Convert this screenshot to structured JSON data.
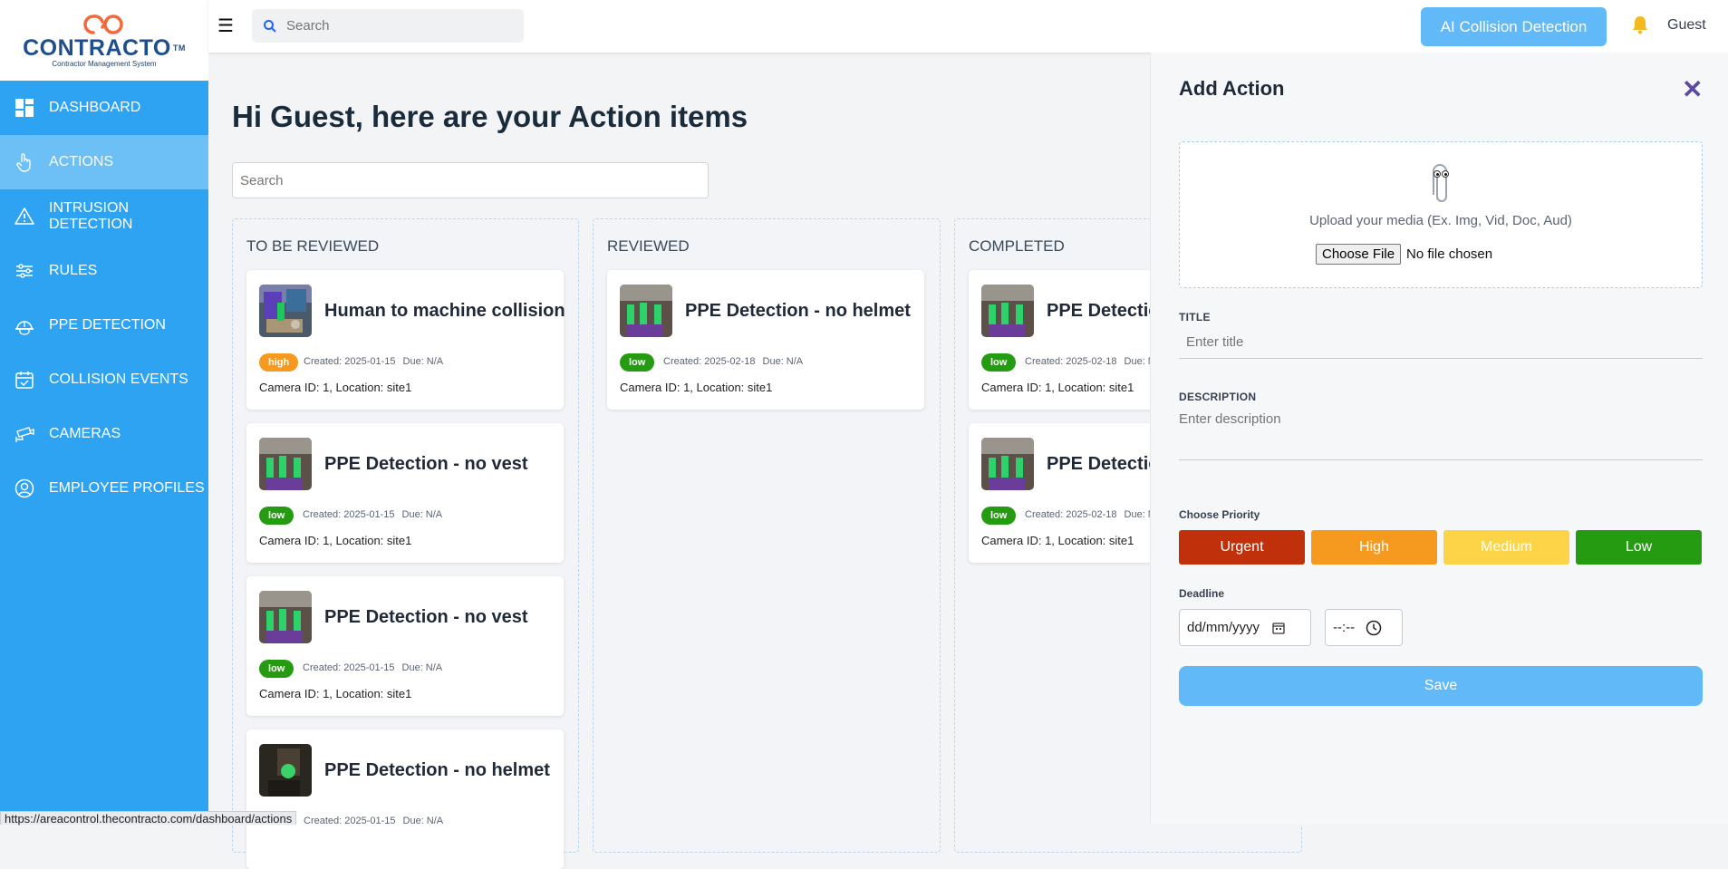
{
  "logo": {
    "name": "CONTRACTO",
    "tm": "TM",
    "subtitle": "Contractor Management System"
  },
  "sidebar": {
    "items": [
      {
        "label": "DASHBOARD",
        "icon": "dashboard-icon"
      },
      {
        "label": "ACTIONS",
        "icon": "hand-pointer-icon",
        "active": true
      },
      {
        "label": "INTRUSION DETECTION",
        "icon": "warning-icon"
      },
      {
        "label": "RULES",
        "icon": "sliders-icon"
      },
      {
        "label": "PPE DETECTION",
        "icon": "helmet-icon"
      },
      {
        "label": "COLLISION EVENTS",
        "icon": "calendar-icon"
      },
      {
        "label": "CAMERAS",
        "icon": "camera-icon"
      },
      {
        "label": "EMPLOYEE PROFILES",
        "icon": "user-circle-icon"
      }
    ]
  },
  "topbar": {
    "search_placeholder": "Search",
    "ai_button": "AI Collision Detection",
    "user": "Guest"
  },
  "main": {
    "greeting": "Hi Guest, here are your Action items",
    "search_placeholder": "Search",
    "columns": [
      {
        "title": "TO BE REVIEWED",
        "cards": [
          {
            "title": "Human to machine collision",
            "priority": "high",
            "created": "Created: 2025-01-15",
            "due": "Due: N/A",
            "camera": "Camera ID: 1, Location: site1"
          },
          {
            "title": "PPE Detection - no vest",
            "priority": "low",
            "created": "Created: 2025-01-15",
            "due": "Due: N/A",
            "camera": "Camera ID: 1, Location: site1"
          },
          {
            "title": "PPE Detection - no vest",
            "priority": "low",
            "created": "Created: 2025-01-15",
            "due": "Due: N/A",
            "camera": "Camera ID: 1, Location: site1"
          },
          {
            "title": "PPE Detection - no helmet",
            "priority": "",
            "created": "Created: 2025-01-15",
            "due": "Due: N/A",
            "camera": ""
          }
        ]
      },
      {
        "title": "REVIEWED",
        "cards": [
          {
            "title": "PPE Detection - no helmet",
            "priority": "low",
            "created": "Created: 2025-02-18",
            "due": "Due: N/A",
            "camera": "Camera ID: 1, Location: site1"
          }
        ]
      },
      {
        "title": "COMPLETED",
        "cards": [
          {
            "title": "PPE Detection",
            "priority": "low",
            "created": "Created: 2025-02-18",
            "due": "Due: N/A",
            "camera": "Camera ID: 1, Location: site1"
          },
          {
            "title": "PPE Detection",
            "priority": "low",
            "created": "Created: 2025-02-18",
            "due": "Due: N/A",
            "camera": "Camera ID: 1, Location: site1"
          }
        ]
      }
    ]
  },
  "drawer": {
    "title": "Add Action",
    "upload_text": "Upload your media (Ex. Img, Vid, Doc, Aud)",
    "choose_file": "Choose File",
    "no_file": "No file chosen",
    "title_label": "TITLE",
    "title_placeholder": "Enter title",
    "description_label": "DESCRIPTION",
    "description_placeholder": "Enter description",
    "priority_label": "Choose Priority",
    "priorities": [
      {
        "label": "Urgent",
        "color": "#c0310b"
      },
      {
        "label": "High",
        "color": "#f5991f"
      },
      {
        "label": "Medium",
        "color": "#fdd447"
      },
      {
        "label": "Low",
        "color": "#259b12"
      }
    ],
    "deadline_label": "Deadline",
    "date_placeholder": "dd/mm/yyyy",
    "time_placeholder": "--:--",
    "save": "Save"
  },
  "status_url": "https://areacontrol.thecontracto.com/dashboard/actions",
  "colors": {
    "sidebar": "#2ea3f2",
    "accent": "#62b9f7",
    "badge_high": "#f5991f",
    "badge_low": "#259b12"
  }
}
